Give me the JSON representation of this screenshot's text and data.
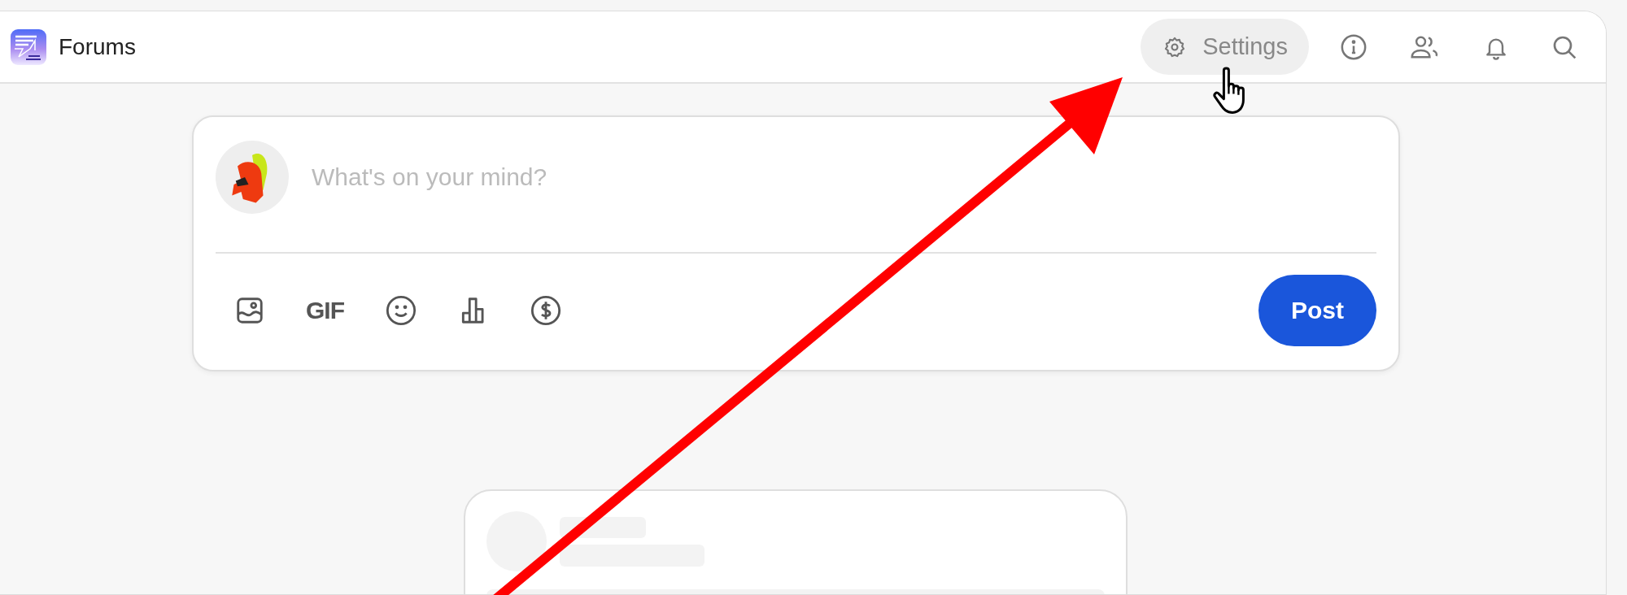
{
  "header": {
    "title": "Forums",
    "settings": {
      "label": "Settings",
      "highlighted": true
    }
  },
  "composer": {
    "placeholder": "What's on your mind?",
    "tools": [
      {
        "kind": "image"
      },
      {
        "kind": "gif",
        "label": "GIF"
      },
      {
        "kind": "emoji"
      },
      {
        "kind": "poll"
      },
      {
        "kind": "money"
      }
    ],
    "post_button": "Post"
  },
  "feed": [
    {
      "kind": "placeholder"
    }
  ]
}
